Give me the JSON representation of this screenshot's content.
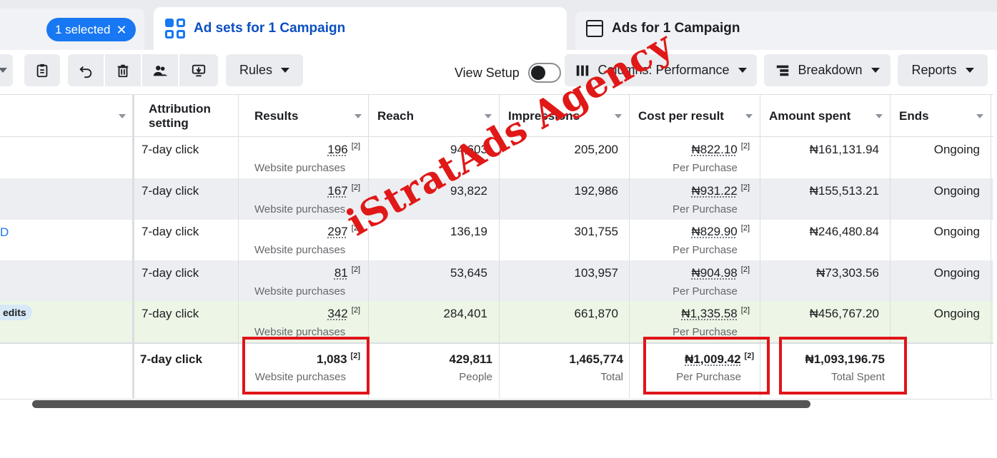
{
  "tabs": {
    "campaigns": {
      "selected_label": "1 selected",
      "close_symbol": "✕"
    },
    "adsets": {
      "label": "Ad sets for 1 Campaign",
      "icon": "grid-icon"
    },
    "ads": {
      "label": "Ads for 1 Campaign",
      "icon": "ad-icon"
    }
  },
  "toolbar": {
    "rules_label": "Rules",
    "view_setup_label": "View Setup",
    "columns_label": "Columns: Performance",
    "breakdown_label": "Breakdown",
    "reports_label": "Reports",
    "icons": [
      "clipboard-icon",
      "undo-icon",
      "trash-icon",
      "people-icon",
      "export-icon"
    ]
  },
  "headers": {
    "attribution": "Attribution setting",
    "results": "Results",
    "reach": "Reach",
    "impressions": "Impressions",
    "cost_per_result": "Cost per result",
    "amount_spent": "Amount spent",
    "ends": "Ends"
  },
  "rows": [
    {
      "attribution": "7-day click",
      "results": "196",
      "results_sub": "Website purchases",
      "reach": "94,603",
      "impressions": "205,200",
      "cpr": "₦822.10",
      "cpr_sub": "Per Purchase",
      "spent": "₦161,131.94",
      "ends": "Ongoing"
    },
    {
      "attribution": "7-day click",
      "results": "167",
      "results_sub": "Website purchases",
      "reach": "93,822",
      "impressions": "192,986",
      "cpr": "₦931.22",
      "cpr_sub": "Per Purchase",
      "spent": "₦155,513.21",
      "ends": "Ongoing"
    },
    {
      "attribution": "7-day click",
      "results": "297",
      "results_sub": "Website purchases",
      "reach": "136,19",
      "impressions": "301,755",
      "cpr": "₦829.90",
      "cpr_sub": "Per Purchase",
      "spent": "₦246,480.84",
      "ends": "Ongoing"
    },
    {
      "attribution": "7-day click",
      "results": "81",
      "results_sub": "Website purchases",
      "reach": "53,645",
      "impressions": "103,957",
      "cpr": "₦904.98",
      "cpr_sub": "Per Purchase",
      "spent": "₦73,303.56",
      "ends": "Ongoing"
    },
    {
      "attribution": "7-day click",
      "results": "342",
      "results_sub": "Website purchases",
      "reach": "284,401",
      "impressions": "661,870",
      "cpr": "₦1,335.58",
      "cpr_sub": "Per Purchase",
      "spent": "₦456,767.20",
      "ends": "Ongoing"
    }
  ],
  "footnote_marker": "[2]",
  "name_column": {
    "link_fragment": "D",
    "badge": "edits"
  },
  "totals": {
    "attribution": "7-day click",
    "results": "1,083",
    "results_sub": "Website purchases",
    "reach": "429,811",
    "reach_sub": "People",
    "impressions": "1,465,774",
    "impressions_sub": "Total",
    "cpr": "₦1,009.42",
    "cpr_sub": "Per Purchase",
    "spent": "₦1,093,196.75",
    "spent_sub": "Total Spent"
  },
  "watermark": "iStratAds Agency",
  "colors": {
    "accent": "#1877f2",
    "highlight_box": "#e0141b",
    "watermark": "#e01818",
    "highlight_row": "#edf6e6"
  }
}
